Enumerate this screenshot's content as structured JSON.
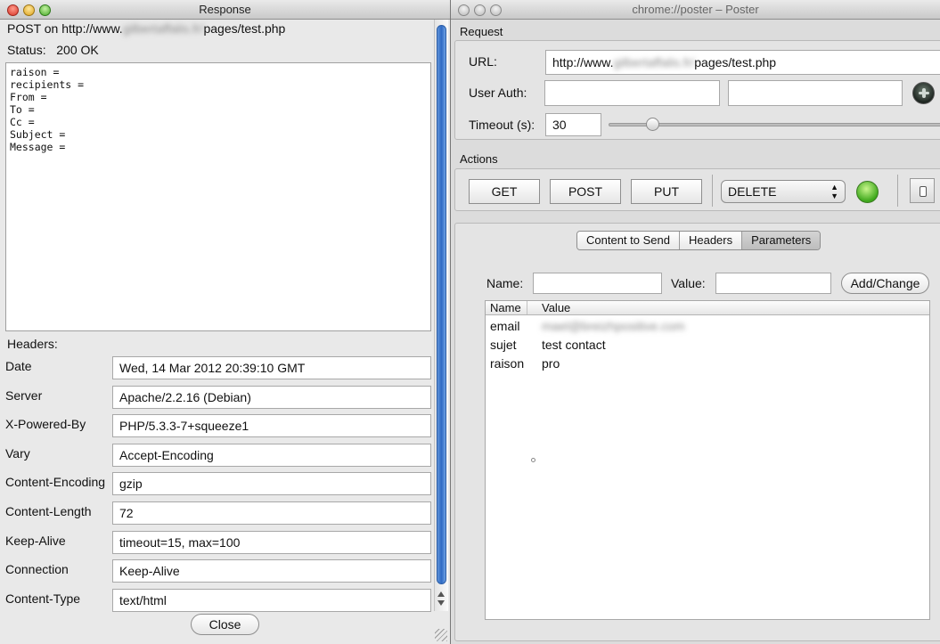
{
  "response": {
    "title": "Response",
    "request_prefix": "POST on http://www.",
    "request_host_blurred": "gilbertaffalis.fr/",
    "request_path": "pages/test.php",
    "status_label": "Status:",
    "status_value": "200 OK",
    "body_lines": [
      "raison =",
      "recipients =",
      "From =",
      "To =",
      "Cc =",
      "Subject =",
      "Message ="
    ],
    "headers_title": "Headers:",
    "headers": [
      {
        "name": "Date",
        "value": "Wed, 14 Mar 2012 20:39:10 GMT"
      },
      {
        "name": "Server",
        "value": "Apache/2.2.16 (Debian)"
      },
      {
        "name": "X-Powered-By",
        "value": "PHP/5.3.3-7+squeeze1"
      },
      {
        "name": "Vary",
        "value": "Accept-Encoding"
      },
      {
        "name": "Content-Encoding",
        "value": "gzip"
      },
      {
        "name": "Content-Length",
        "value": "72"
      },
      {
        "name": "Keep-Alive",
        "value": "timeout=15, max=100"
      },
      {
        "name": "Connection",
        "value": "Keep-Alive"
      },
      {
        "name": "Content-Type",
        "value": "text/html"
      }
    ],
    "close_label": "Close"
  },
  "poster": {
    "title": "chrome://poster – Poster",
    "request": {
      "section_title": "Request",
      "url_label": "URL:",
      "url_prefix": "http://www.",
      "url_host_blurred": "gilbertaffalis.fr/",
      "url_path": "pages/test.php",
      "user_auth_label": "User Auth:",
      "user_auth_user": "",
      "user_auth_password": "",
      "timeout_label": "Timeout (s):",
      "timeout_value": "30",
      "timeout_slider_fraction": 0.13
    },
    "actions": {
      "section_title": "Actions",
      "get_label": "GET",
      "post_label": "POST",
      "put_label": "PUT",
      "method_selected": "DELETE"
    },
    "tabs": [
      "Content to Send",
      "Headers",
      "Parameters"
    ],
    "active_tab": 2,
    "params": {
      "name_label": "Name:",
      "value_label": "Value:",
      "name_value": "",
      "value_value": "",
      "add_label": "Add/Change",
      "columns": [
        "Name",
        "Value"
      ],
      "rows": [
        {
          "name": "email",
          "value": "mael@breizhpositive.com",
          "blurred": true
        },
        {
          "name": "sujet",
          "value": "test contact",
          "blurred": false
        },
        {
          "name": "raison",
          "value": "pro",
          "blurred": false
        }
      ]
    }
  },
  "icons": {
    "auth_key": "keyhole-icon",
    "status_light": "green-status-light-icon",
    "side_toggle": "pane-toggle-icon",
    "resize": "resize-grip-icon"
  }
}
